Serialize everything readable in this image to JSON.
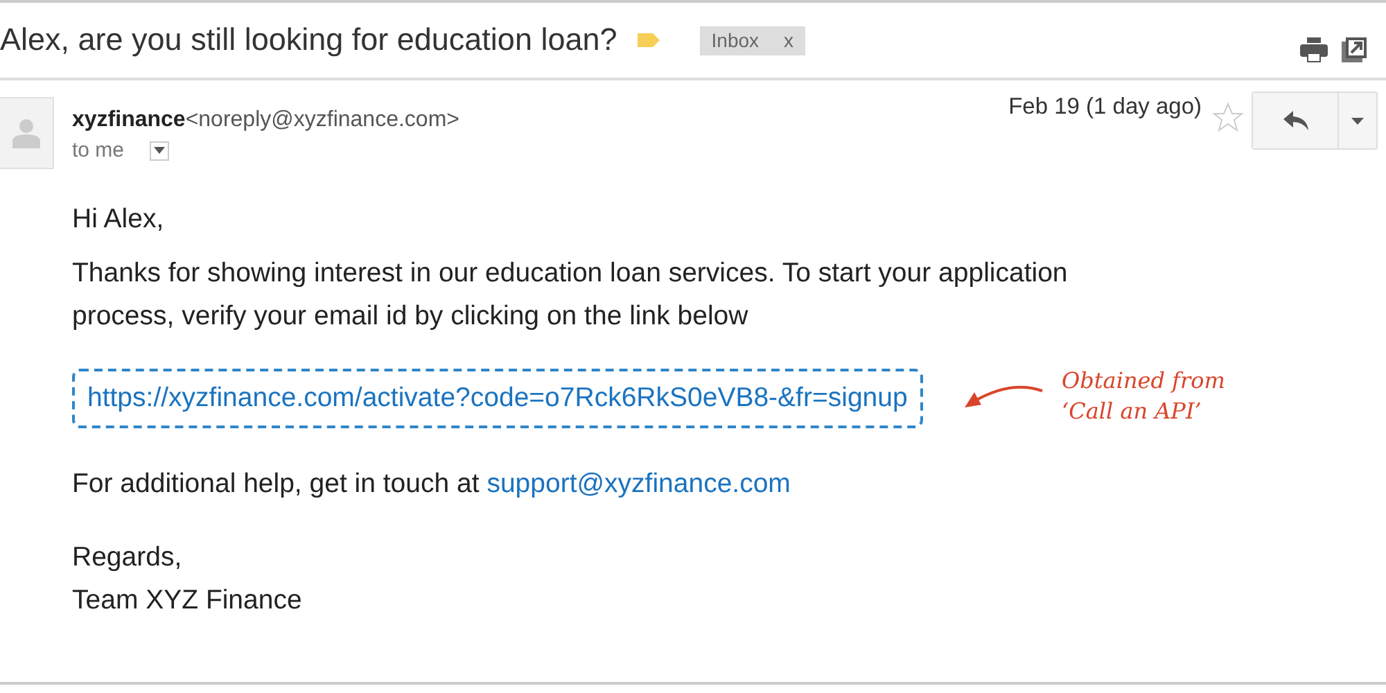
{
  "subject": "Alex, are you still looking for education loan?",
  "label": {
    "text": "Inbox",
    "remove": "x"
  },
  "message": {
    "sender_name": "xyzfinance",
    "sender_email": "<noreply@xyzfinance.com>",
    "recipient": "to me",
    "date": "Feb 19 (1 day ago)",
    "starred": false
  },
  "body": {
    "greeting": "Hi Alex,",
    "paragraph": "Thanks for showing interest in our education loan services. To start your application process, verify your email id by clicking on the link below",
    "link": "https://xyzfinance.com/activate?code=o7Rck6RkS0eVB8-&fr=signup",
    "help_text": "For additional help, get in touch at ",
    "help_link": "support@xyzfinance.com",
    "closing": "Regards,",
    "signature": "Team XYZ Finance"
  },
  "annotation": {
    "lines": [
      "Obtained from",
      "‘Call an API’"
    ]
  }
}
